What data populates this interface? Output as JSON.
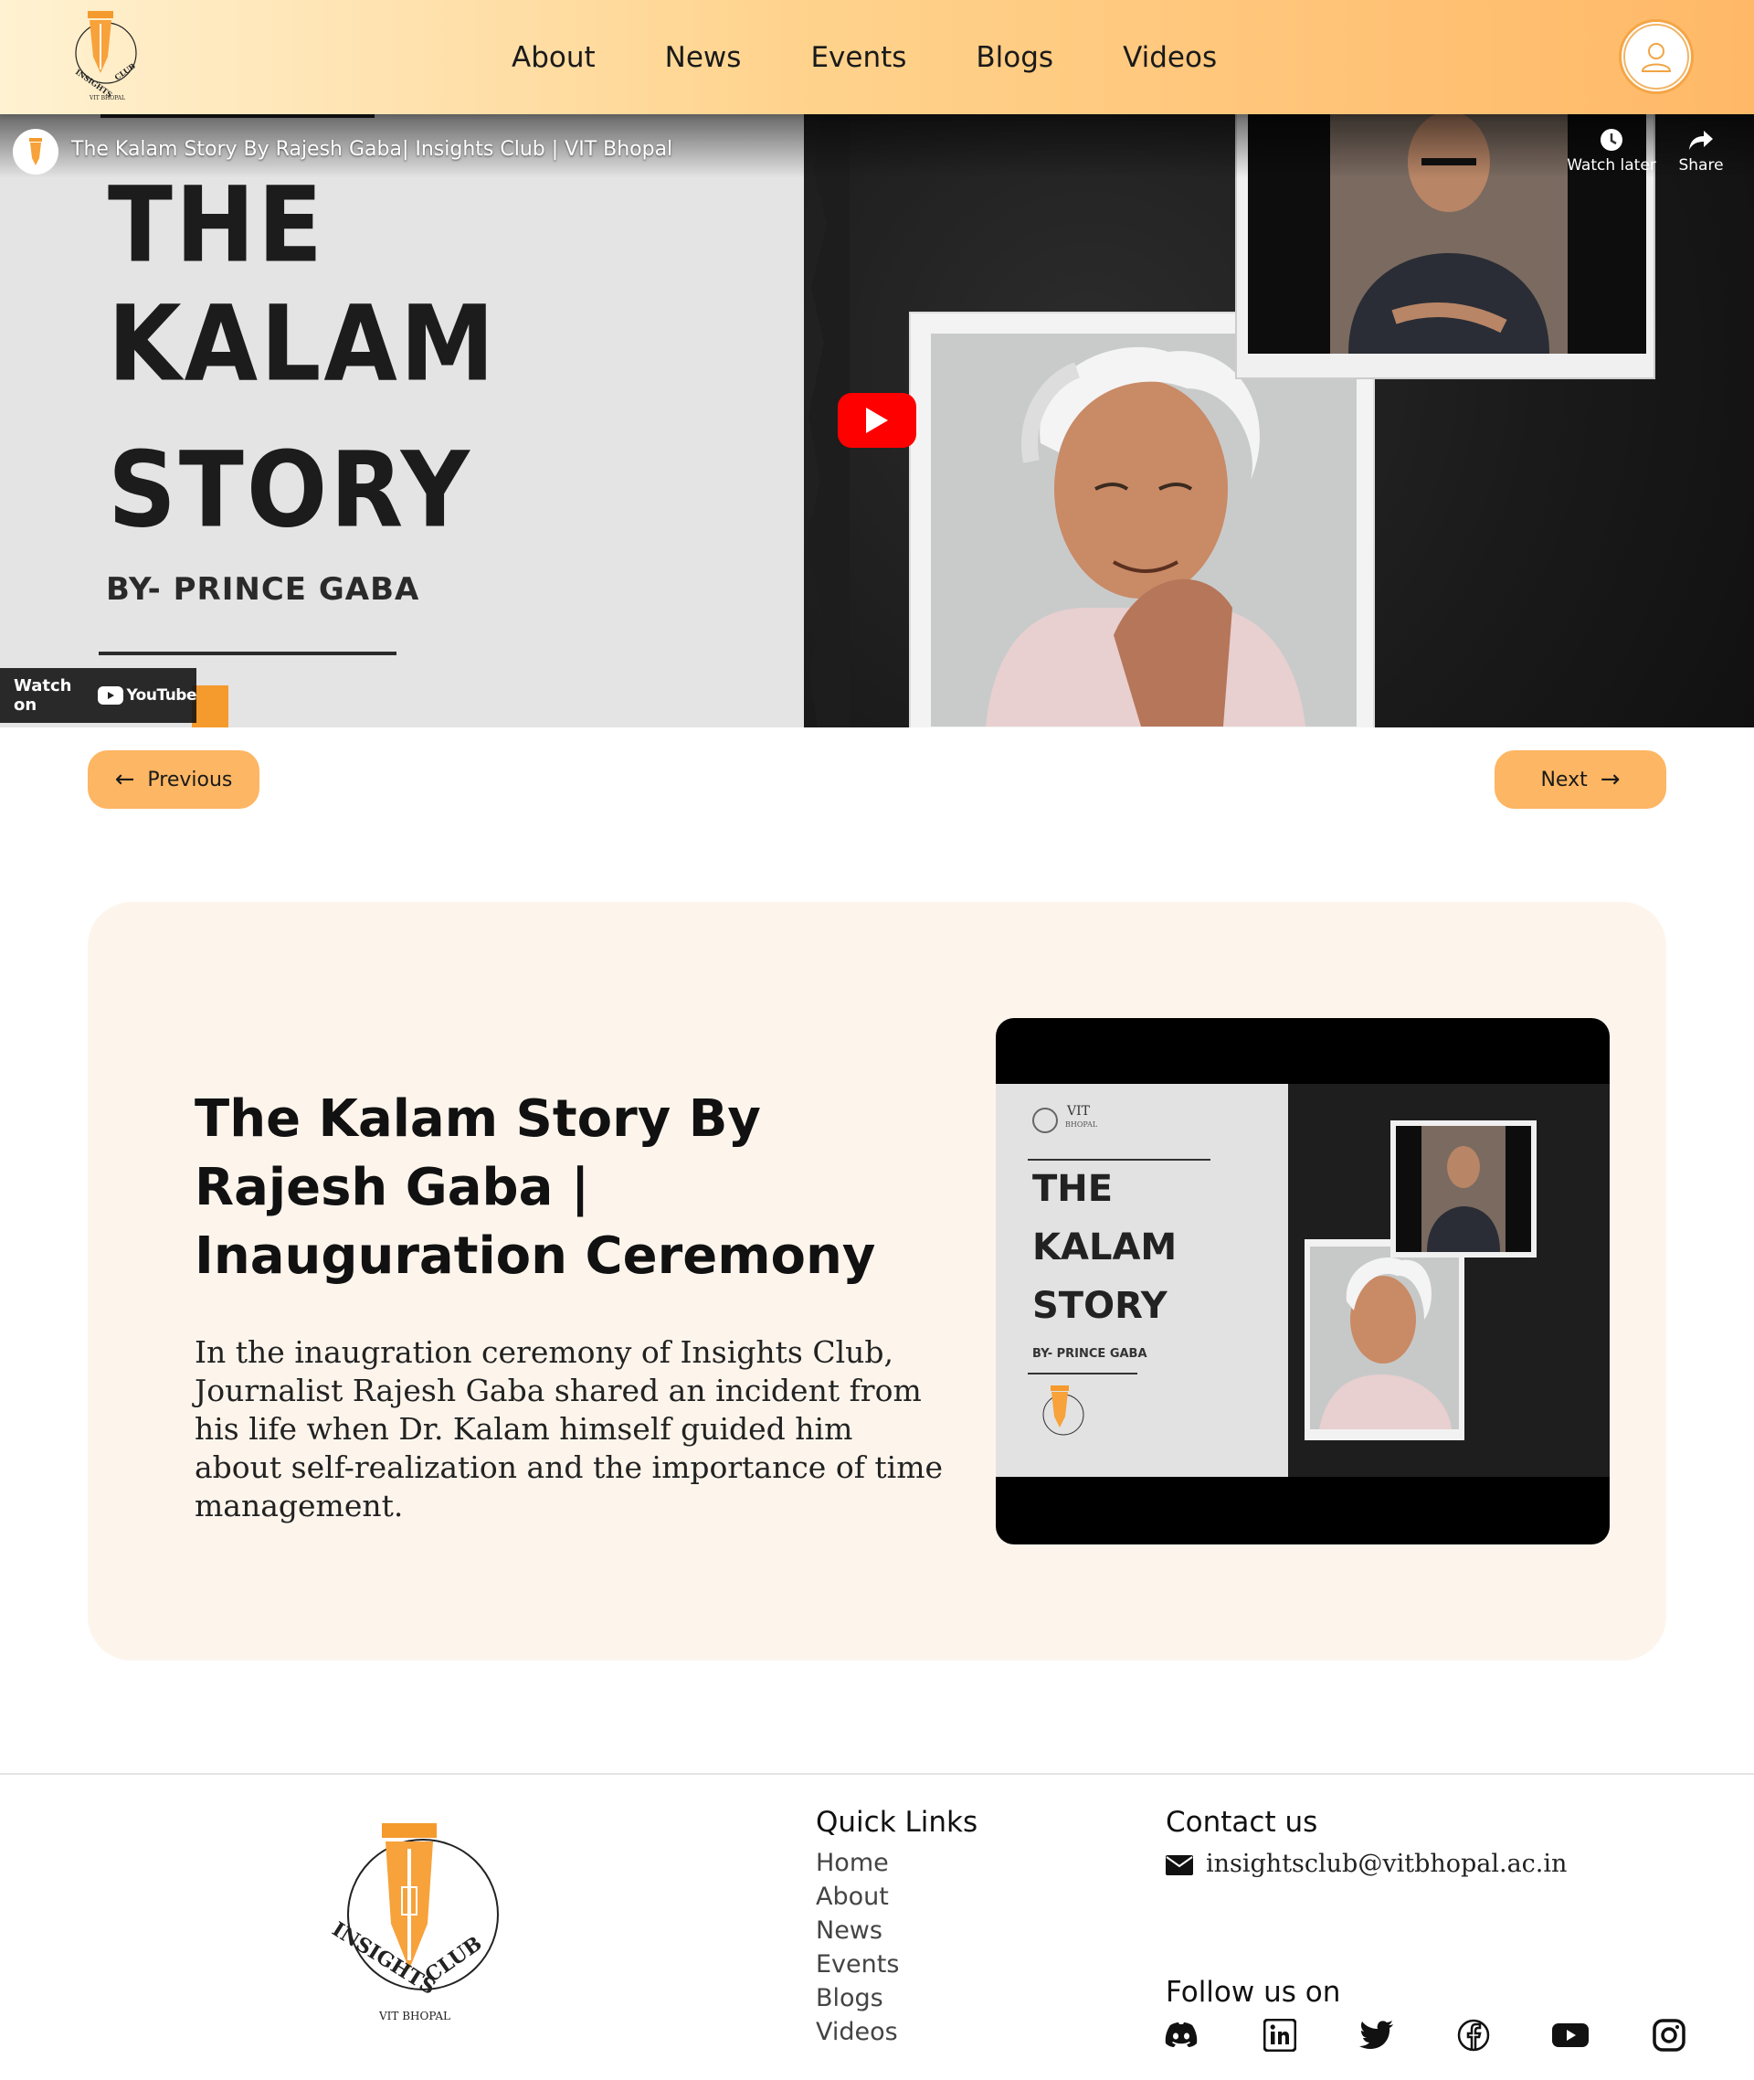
{
  "nav": {
    "links": [
      "About",
      "News",
      "Events",
      "Blogs",
      "Videos"
    ],
    "logo_text": "INSIGHTS CLUB",
    "logo_sub": "VIT BHOPAL"
  },
  "video": {
    "title": "The Kalam Story By Rajesh Gaba| Insights Club | VIT Bhopal",
    "watch_later": "Watch later",
    "share": "Share",
    "watch_on": "Watch on",
    "youtube": "YouTube",
    "thumb_lines": [
      "THE",
      "KALAM",
      "STORY"
    ],
    "thumb_by": "BY- PRINCE GABA"
  },
  "pager": {
    "previous": "Previous",
    "next": "Next"
  },
  "card": {
    "title": "The Kalam Story By Rajesh Gaba | Inauguration Ceremony",
    "description": "In the inaugration ceremony of Insights Club, Journalist Rajesh Gaba shared an incident from his life when Dr. Kalam himself guided him about self-realization and the importance of time management.",
    "thumb_vit": "VIT",
    "thumb_vit_sub": "BHOPAL",
    "thumb_lines": [
      "THE",
      "KALAM",
      "STORY"
    ],
    "thumb_by": "BY- PRINCE GABA"
  },
  "footer": {
    "logo_text_left": "INSIGHTS",
    "logo_text_right": "CLUB",
    "logo_sub": "VIT BHOPAL",
    "quick_links_title": "Quick Links",
    "quick_links": [
      "Home",
      "About",
      "News",
      "Events",
      "Blogs",
      "Videos"
    ],
    "contact_title": "Contact us",
    "email": "insightsclub@vitbhopal.ac.in",
    "follow_title": "Follow us on",
    "socials": [
      "discord-icon",
      "linkedin-icon",
      "twitter-icon",
      "facebook-icon",
      "youtube-icon",
      "instagram-icon"
    ]
  },
  "colors": {
    "accent": "#fdb663",
    "card_bg": "#fdf5ec",
    "youtube_red": "#ff0000"
  }
}
